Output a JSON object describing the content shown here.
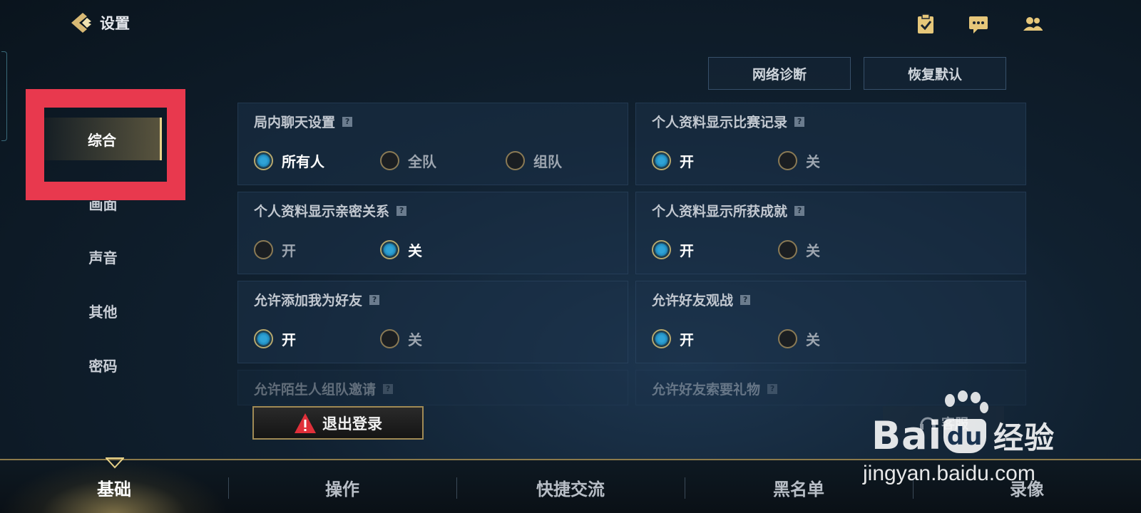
{
  "header": {
    "title": "设置"
  },
  "sidebar": {
    "items": [
      {
        "label": "综合",
        "active": true
      },
      {
        "label": "画面",
        "active": false
      },
      {
        "label": "声音",
        "active": false
      },
      {
        "label": "其他",
        "active": false
      },
      {
        "label": "密码",
        "active": false
      }
    ]
  },
  "actions": {
    "network_label": "网络诊断",
    "reset_label": "恢复默认"
  },
  "help_glyph": "?",
  "settings": [
    {
      "title": "局内聊天设置",
      "options": [
        "所有人",
        "全队",
        "组队"
      ],
      "selected": 0
    },
    {
      "title": "个人资料显示比赛记录",
      "options": [
        "开",
        "关"
      ],
      "selected": 0
    },
    {
      "title": "个人资料显示亲密关系",
      "options": [
        "开",
        "关"
      ],
      "selected": 1
    },
    {
      "title": "个人资料显示所获成就",
      "options": [
        "开",
        "关"
      ],
      "selected": 0
    },
    {
      "title": "允许添加我为好友",
      "options": [
        "开",
        "关"
      ],
      "selected": 0
    },
    {
      "title": "允许好友观战",
      "options": [
        "开",
        "关"
      ],
      "selected": 0
    },
    {
      "title": "允许陌生人组队邀请"
    },
    {
      "title": "允许好友索要礼物"
    }
  ],
  "logout_label": "退出登录",
  "service_label": "客服",
  "bottom_tabs": [
    {
      "label": "基础",
      "active": true
    },
    {
      "label": "操作",
      "active": false
    },
    {
      "label": "快捷交流",
      "active": false
    },
    {
      "label": "黑名单",
      "active": false
    },
    {
      "label": "录像",
      "active": false
    }
  ],
  "watermark": {
    "logo_left": "Bai",
    "logo_mid": "du",
    "logo_right": "经验",
    "url": "jingyan.baidu.com"
  },
  "colors": {
    "accent_gold": "#e9d38a",
    "highlight_red": "#e8394e",
    "radio_blue": "#2fa3d6"
  }
}
